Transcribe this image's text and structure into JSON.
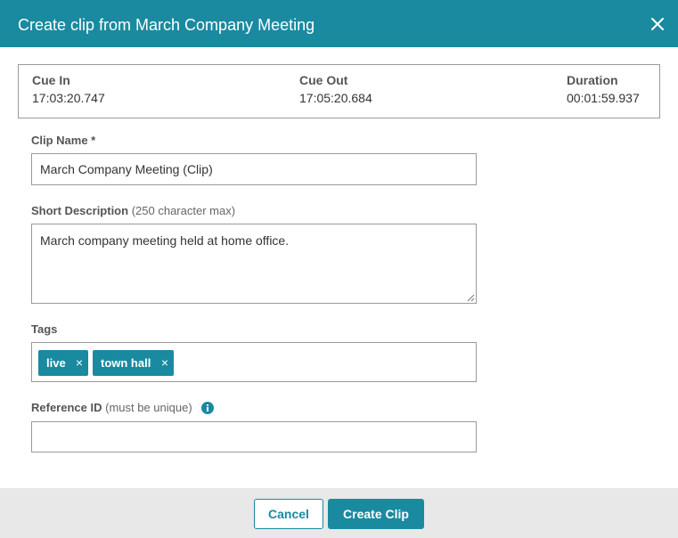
{
  "dialog": {
    "title": "Create clip from March Company Meeting"
  },
  "cue": {
    "in_label": "Cue In",
    "in_value": "17:03:20.747",
    "out_label": "Cue Out",
    "out_value": "17:05:20.684",
    "duration_label": "Duration",
    "duration_value": "00:01:59.937"
  },
  "form": {
    "clip_name_label": "Clip Name *",
    "clip_name_value": "March Company Meeting (Clip)",
    "description_label": "Short Description",
    "description_hint": "(250 character max)",
    "description_value": "March company meeting held at home office.",
    "tags_label": "Tags",
    "tags": [
      {
        "label": "live",
        "remove": "×"
      },
      {
        "label": "town hall",
        "remove": "×"
      }
    ],
    "reference_label": "Reference ID",
    "reference_hint": "(must be unique)",
    "reference_value": ""
  },
  "footer": {
    "cancel_label": "Cancel",
    "create_label": "Create Clip"
  },
  "colors": {
    "accent": "#1a8aa0",
    "footer_bg": "#e8e8e8"
  },
  "icons": {
    "close": "close-icon",
    "info": "info-icon"
  }
}
